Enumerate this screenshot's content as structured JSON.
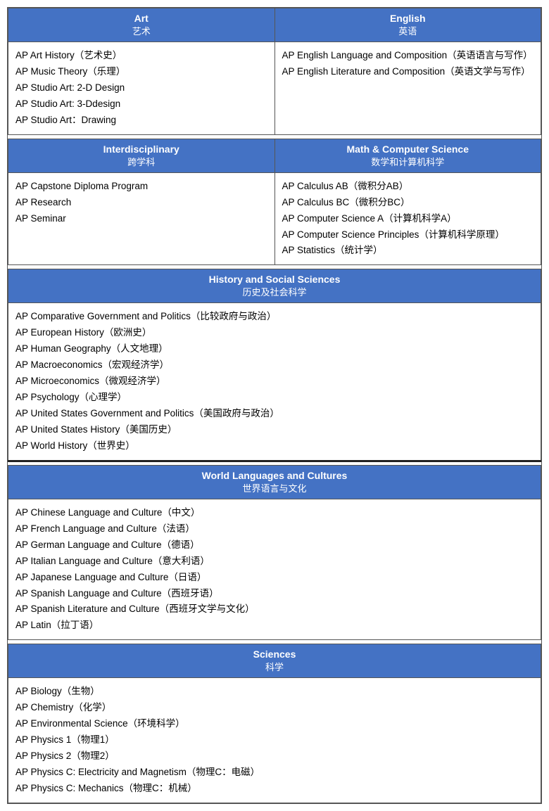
{
  "sections": {
    "row1": {
      "col1": {
        "header_en": "Art",
        "header_zh": "艺术",
        "items": [
          "AP Art History（艺术史）",
          "AP Music Theory（乐理）",
          "AP Studio Art: 2-D Design",
          "AP Studio Art: 3-Ddesign",
          "AP Studio Art：Drawing"
        ]
      },
      "col2": {
        "header_en": "English",
        "header_zh": "英语",
        "items": [
          "AP English Language and Composition（英语语言与写作）",
          "AP English Literature and Composition（英语文学与写作）"
        ]
      }
    },
    "row2": {
      "col1": {
        "header_en": "Interdisciplinary",
        "header_zh": "跨学科",
        "items": [
          "AP Capstone Diploma Program",
          "AP Research",
          "AP Seminar"
        ]
      },
      "col2": {
        "header_en": "Math & Computer Science",
        "header_zh": "数学和计算机科学",
        "items": [
          "AP Calculus AB（微积分AB）",
          "AP Calculus BC（微积分BC）",
          "AP Computer Science A（计算机科学A）",
          "AP Computer Science Principles（计算机科学原理）",
          "AP Statistics（统计学）"
        ]
      }
    },
    "history": {
      "header_en": "History and Social Sciences",
      "header_zh": "历史及社会科学",
      "items": [
        "AP Comparative Government and Politics（比较政府与政治）",
        "AP European History（欧洲史）",
        "AP Human Geography（人文地理）",
        "AP Macroeconomics（宏观经济学）",
        "AP Microeconomics（微观经济学）",
        "AP Psychology（心理学）",
        "AP United States Government and Politics（美国政府与政治）",
        "AP United States History（美国历史）",
        "AP World History（世界史）"
      ]
    },
    "world_languages": {
      "header_en": "World Languages and Cultures",
      "header_zh": "世界语言与文化",
      "items": [
        "AP Chinese Language and Culture（中文）",
        "AP French Language and Culture（法语）",
        "AP German Language and Culture（德语）",
        "AP Italian Language and Culture（意大利语）",
        "AP Japanese Language and Culture（日语）",
        "AP Spanish Language and Culture（西班牙语）",
        "AP Spanish Literature and Culture（西班牙文学与文化）",
        "AP Latin（拉丁语）"
      ]
    },
    "sciences": {
      "header_en": "Sciences",
      "header_zh": "科学",
      "items": [
        "AP Biology（生物）",
        "AP Chemistry（化学）",
        "AP Environmental Science（环境科学）",
        "AP Physics 1（物理1）",
        "AP Physics 2（物理2）",
        "AP Physics C: Electricity and Magnetism（物理C：电磁）",
        "AP Physics C: Mechanics（物理C：机械）"
      ]
    }
  }
}
